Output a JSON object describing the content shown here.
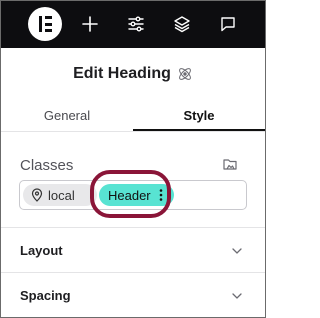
{
  "topbar": {
    "logo": "elementor-logo-icon",
    "icons": [
      "plus-icon",
      "sliders-icon",
      "layers-icon",
      "chat-icon"
    ]
  },
  "panel": {
    "title": "Edit Heading",
    "title_icon": "atom-icon"
  },
  "tabs": [
    {
      "label": "General",
      "active": false
    },
    {
      "label": "Style",
      "active": true
    }
  ],
  "classes": {
    "label": "Classes",
    "chips": [
      {
        "label": "local",
        "icon": "location-pin-icon"
      },
      {
        "label": "Header",
        "icon": "more-vertical-icon",
        "color": "#58e3d2"
      }
    ],
    "highlight_color": "#8a1538"
  },
  "sections": [
    {
      "label": "Layout"
    },
    {
      "label": "Spacing"
    }
  ]
}
